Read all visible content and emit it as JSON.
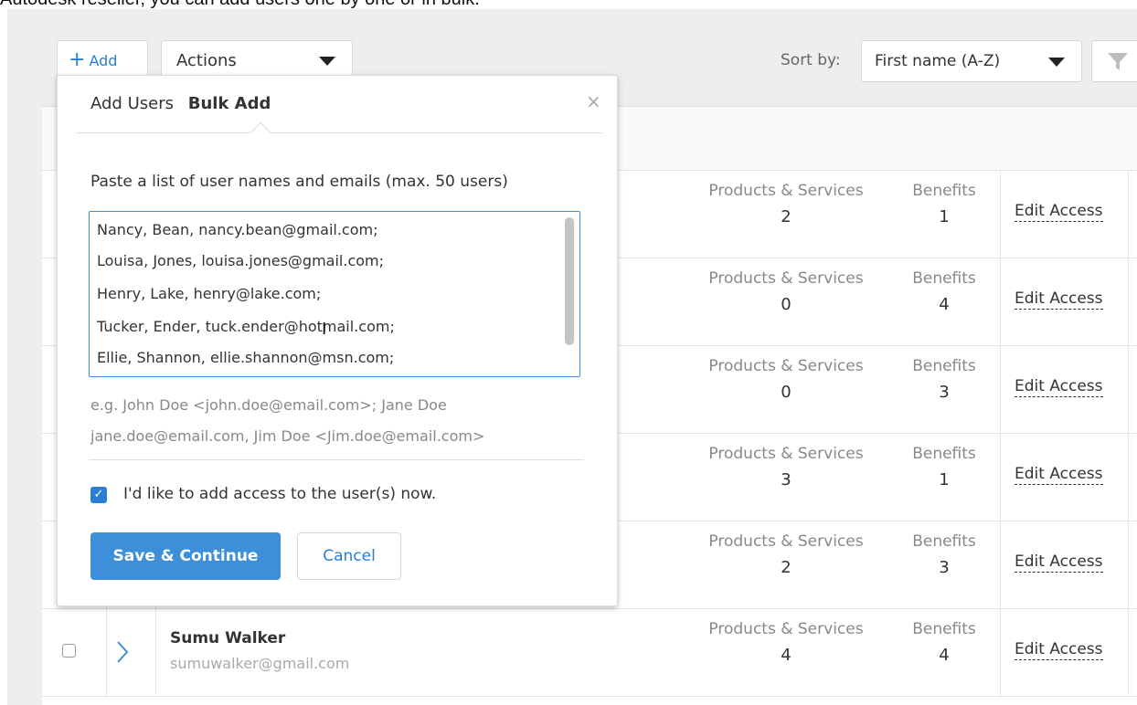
{
  "caption": "Autodesk reseller, you can add users one by one or in bulk.",
  "toolbar": {
    "add_label": "Add",
    "actions_label": "Actions",
    "sort_label": "Sort by:",
    "sort_value": "First name (A-Z)"
  },
  "popup": {
    "tab_add_users": "Add Users",
    "tab_bulk_add": "Bulk Add",
    "close_symbol": "×",
    "paste_label": "Paste a list of user names and emails (max. 50 users)",
    "textarea_lines": [
      "Nancy, Bean, nancy.bean@gmail.com;",
      "Louisa, Jones, louisa.jones@gmail.com;",
      "Henry, Lake, henry@lake.com;",
      "Tucker, Ender, tuck.ender@hotmail.com;",
      "Ellie, Shannon, ellie.shannon@msn.com;"
    ],
    "example_line1": "e.g. John Doe <john.doe@email.com>; Jane Doe",
    "example_line2": "jane.doe@email.com, Jim Doe <Jim.doe@email.com>",
    "access_checked": true,
    "access_label": "I'd like to add access to the user(s) now.",
    "save_label": "Save & Continue",
    "cancel_label": "Cancel"
  },
  "table": {
    "ps_label": "Products & Services",
    "benefits_label": "Benefits",
    "edit_label": "Edit Access",
    "rows": [
      {
        "ps": "2",
        "benefits": "1"
      },
      {
        "ps": "0",
        "benefits": "4"
      },
      {
        "ps": "0",
        "benefits": "3"
      },
      {
        "ps": "3",
        "benefits": "1"
      },
      {
        "ps": "2",
        "benefits": "3"
      },
      {
        "name": "Sumu Walker",
        "email": "sumuwalker@gmail.com",
        "ps": "4",
        "benefits": "4"
      }
    ]
  }
}
